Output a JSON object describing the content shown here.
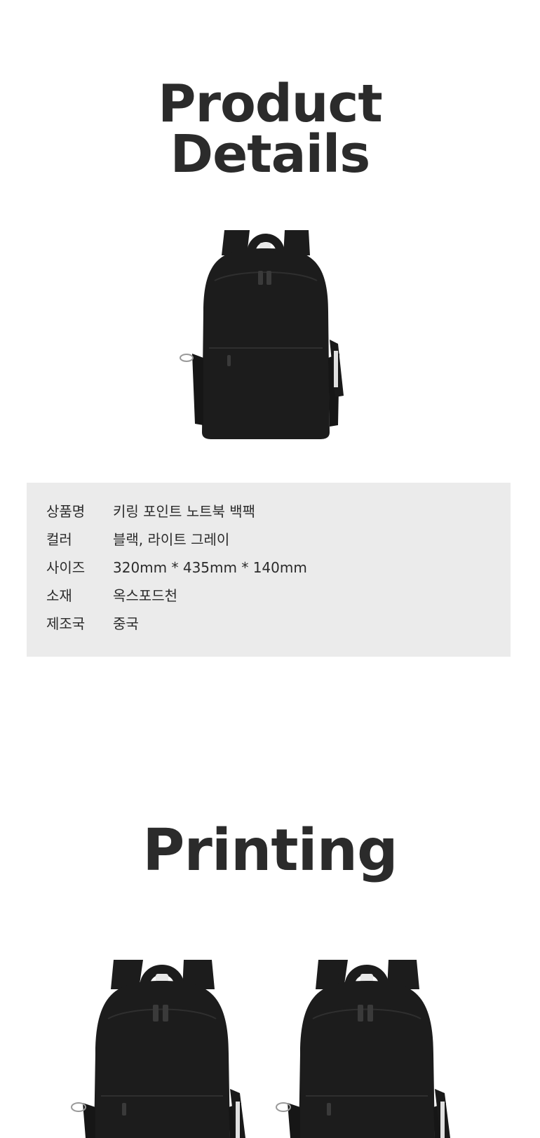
{
  "sections": {
    "details_title_line1": "Product",
    "details_title_line2": "Details",
    "printing_title": "Printing"
  },
  "specs": [
    {
      "label": "상품명",
      "value": "키링 포인트 노트북 백팩"
    },
    {
      "label": "컬러",
      "value": "블랙, 라이트 그레이"
    },
    {
      "label": "사이즈",
      "value": "320mm * 435mm * 140mm"
    },
    {
      "label": "소재",
      "value": "옥스포드천"
    },
    {
      "label": "제조국",
      "value": "중국"
    }
  ],
  "colors": {
    "text": "#2b2b2b",
    "panel_bg": "#ebebeb",
    "bag": "#1c1c1c"
  },
  "images": [
    {
      "name": "backpack-photo-main",
      "depicts": "black backpack"
    },
    {
      "name": "backpack-photo-printing-left",
      "depicts": "black backpack"
    },
    {
      "name": "backpack-photo-printing-right",
      "depicts": "black backpack"
    }
  ]
}
